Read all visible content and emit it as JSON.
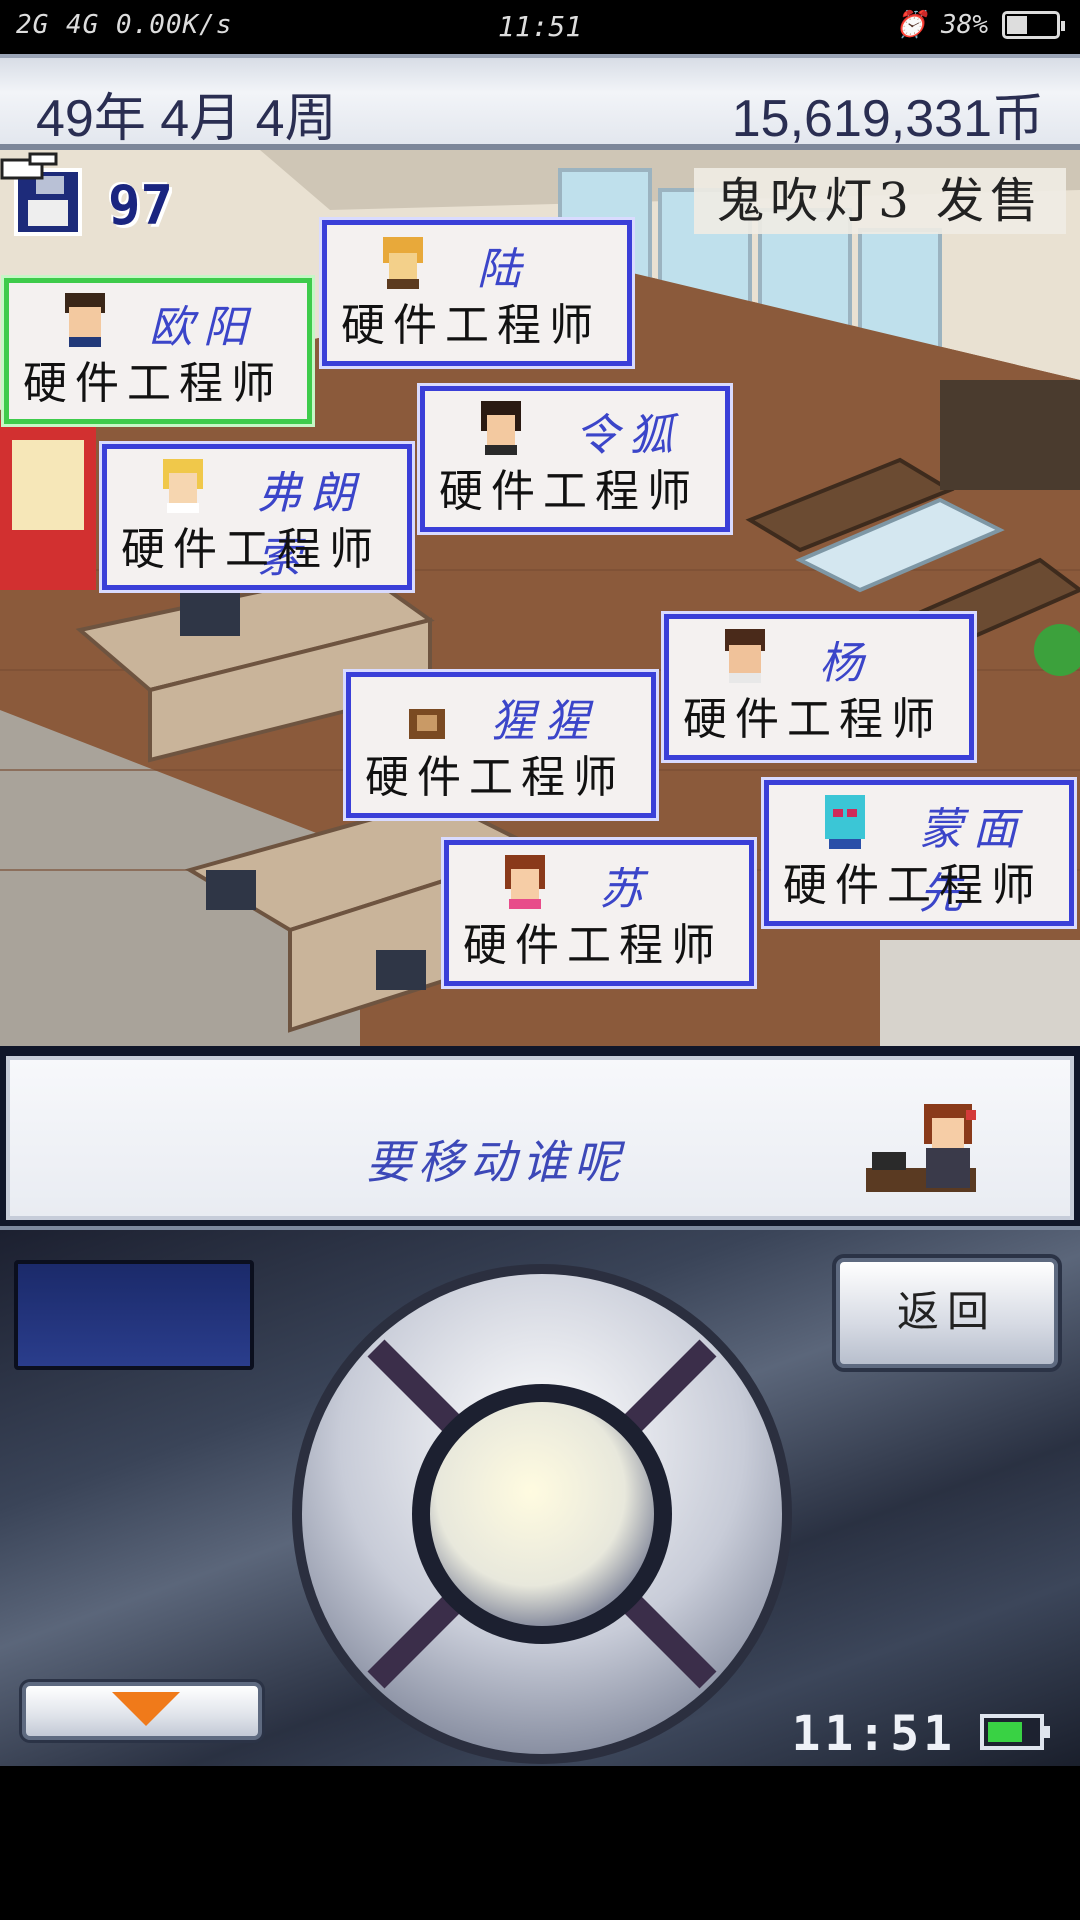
{
  "status_bar": {
    "network": "2G 4G 0.00K/s",
    "time": "11:51",
    "battery": "38%",
    "battery_level": 0.38,
    "icons": [
      "signal-icon",
      "wifi-icon",
      "more-icon",
      "silent-icon",
      "alarm-icon",
      "battery-icon"
    ]
  },
  "header": {
    "date": "49年 4月 4周",
    "money": "15,619,331币"
  },
  "scene": {
    "save_count": "97",
    "release_notice": "鬼吹灯3 发售",
    "employees": [
      {
        "name": "欧阳",
        "role": "硬件工程师",
        "selected": true
      },
      {
        "name": "陆",
        "role": "硬件工程师",
        "selected": false
      },
      {
        "name": "令狐",
        "role": "硬件工程师",
        "selected": false
      },
      {
        "name": "弗朗索",
        "role": "硬件工程师",
        "selected": false
      },
      {
        "name": "杨",
        "role": "硬件工程师",
        "selected": false
      },
      {
        "name": "猩猩",
        "role": "硬件工程师",
        "selected": false
      },
      {
        "name": "蒙面先",
        "role": "硬件工程师",
        "selected": false
      },
      {
        "name": "苏",
        "role": "硬件工程师",
        "selected": false
      }
    ]
  },
  "message": {
    "text": "要移动谁呢"
  },
  "controls": {
    "back_label": "返回",
    "clock": "11:51",
    "battery_level": 0.6,
    "accent": "#f07a1a",
    "battery_color": "#39d244"
  }
}
